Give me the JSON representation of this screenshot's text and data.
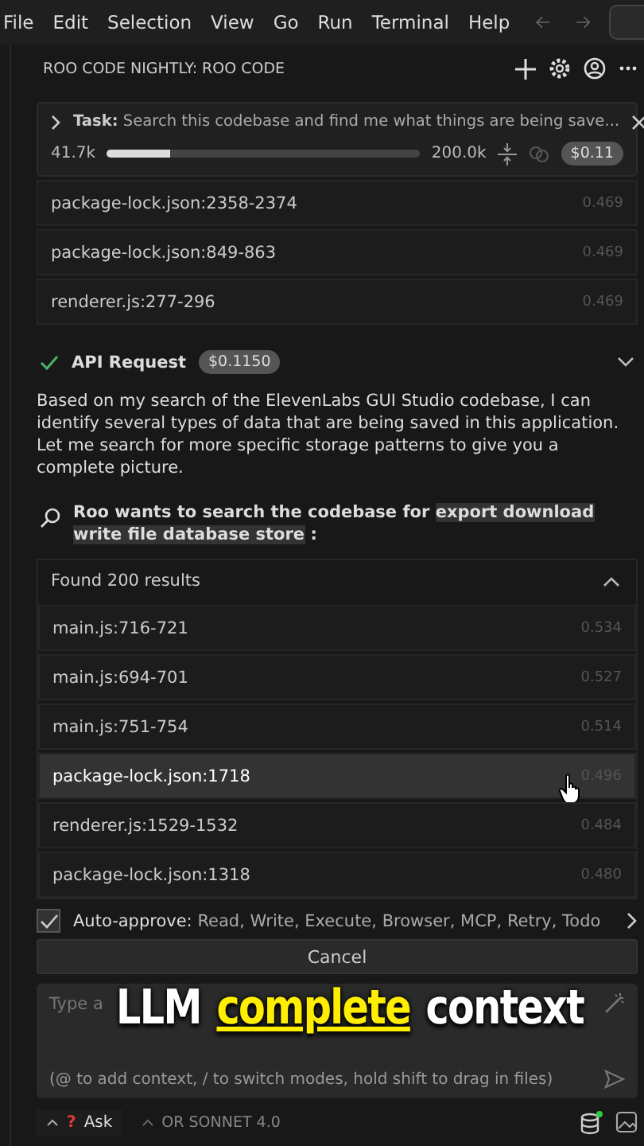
{
  "menu": [
    "File",
    "Edit",
    "Selection",
    "View",
    "Go",
    "Run",
    "Terminal",
    "Help"
  ],
  "panel": {
    "title": "ROO CODE NIGHTLY: ROO CODE"
  },
  "task": {
    "label": "Task:",
    "text": "Search this codebase and find me what things are being save...",
    "tokens_used": "41.7k",
    "level": 0.2,
    "tokens_max": "200.0k",
    "cost": "$0.11"
  },
  "prev_results": [
    {
      "file": "package-lock.json:2358-2374",
      "score": "0.469"
    },
    {
      "file": "package-lock.json:849-863",
      "score": "0.469"
    },
    {
      "file": "renderer.js:277-296",
      "score": "0.469"
    }
  ],
  "api_request": {
    "label": "API Request",
    "cost": "$0.1150",
    "done": true
  },
  "message": "Based on my search of the ElevenLabs GUI Studio codebase, I can identify several types of data that are being saved in this application. Let me search for more specific storage patterns to give you a complete picture.",
  "search": {
    "lead": "Roo wants to search the codebase for",
    "query": "export download write file database store",
    "tail": ":"
  },
  "results": {
    "header": "Found 200 results",
    "expanded": true,
    "items": [
      {
        "file": "main.js:716-721",
        "score": "0.534",
        "selected": false
      },
      {
        "file": "main.js:694-701",
        "score": "0.527",
        "selected": false
      },
      {
        "file": "main.js:751-754",
        "score": "0.514",
        "selected": false
      },
      {
        "file": "package-lock.json:1718",
        "score": "0.496",
        "selected": true
      },
      {
        "file": "renderer.js:1529-1532",
        "score": "0.484",
        "selected": false
      },
      {
        "file": "package-lock.json:1318",
        "score": "0.480",
        "selected": false
      }
    ]
  },
  "auto_approve": {
    "checked": true,
    "label": "Auto-approve:",
    "text": "Read, Write, Execute, Browser, MCP, Retry, Todo"
  },
  "cancel": "Cancel",
  "input": {
    "placeholder": "Type a",
    "hint": "(@ to add context, / to switch modes, hold shift to drag in files)"
  },
  "mode": {
    "icon": "?",
    "label": "Ask"
  },
  "model": "OR SONNET 4.0",
  "caption": [
    {
      "text": "LLM",
      "highlight": false
    },
    {
      "text": "complete",
      "highlight": true
    },
    {
      "text": "context",
      "highlight": false
    }
  ]
}
